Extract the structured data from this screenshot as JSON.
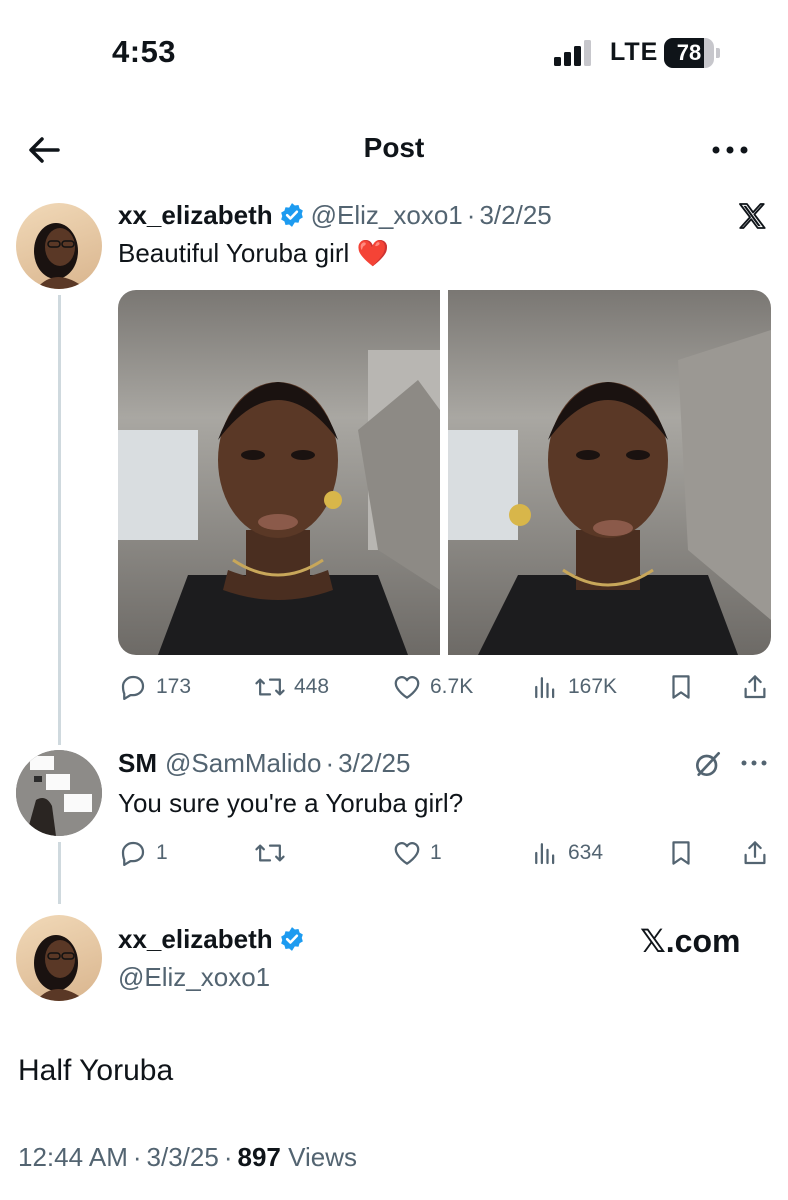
{
  "status_bar": {
    "time": "4:53",
    "network": "LTE",
    "battery": "78"
  },
  "header": {
    "title": "Post"
  },
  "quoted_post": {
    "display_name": "xx_elizabeth",
    "handle": "@Eliz_xoxo1",
    "separator": "·",
    "date": "3/2/25",
    "text": "Beautiful Yoruba girl",
    "emoji": "❤️",
    "stats": {
      "replies": "173",
      "reposts": "448",
      "likes": "6.7K",
      "views": "167K"
    }
  },
  "reply": {
    "display_name": "SM",
    "handle": "@SamMalido",
    "separator": "·",
    "date": "3/2/25",
    "text": "You sure you're a Yoruba girl?",
    "stats": {
      "replies": "1",
      "reposts": "",
      "likes": "1",
      "views": "634"
    }
  },
  "main_post": {
    "display_name": "xx_elizabeth",
    "handle": "@Eliz_xoxo1",
    "brand": "𝕏.com",
    "text": "Half Yoruba",
    "time": "12:44 AM",
    "separator": "·",
    "date": "3/3/25",
    "views_count": "897",
    "views_label": "Views"
  },
  "colors": {
    "verified": "#1d9bf0",
    "muted": "#536471",
    "thread_line": "#cfd9de"
  }
}
